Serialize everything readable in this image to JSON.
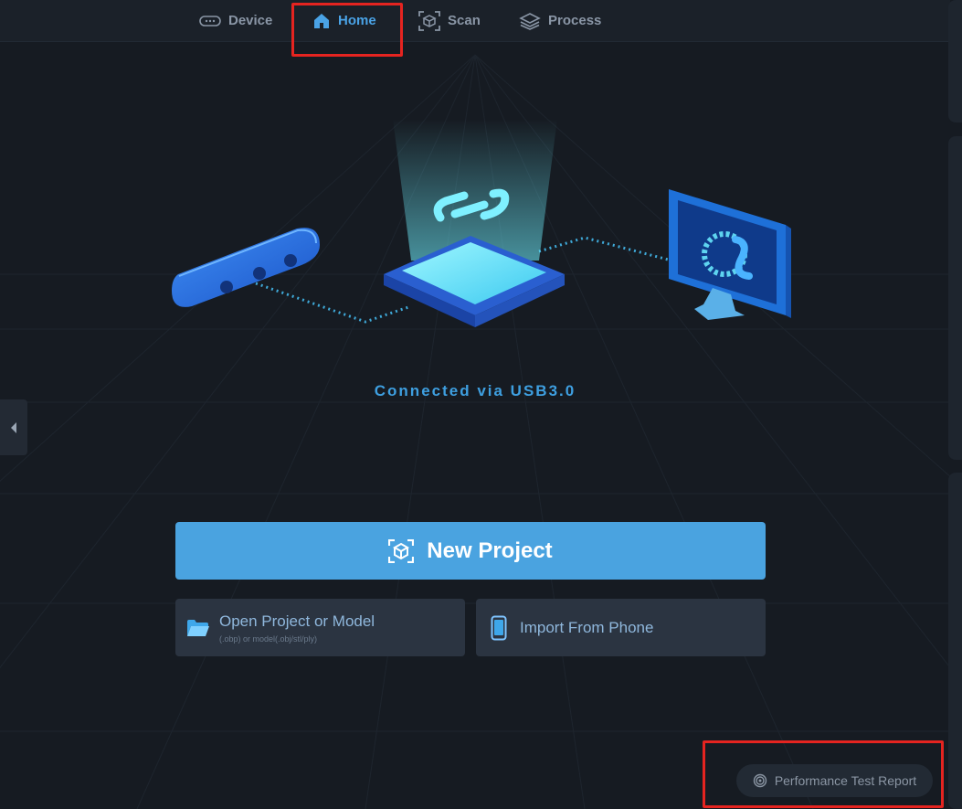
{
  "nav": {
    "tabs": [
      {
        "label": "Device",
        "icon": "device-icon"
      },
      {
        "label": "Home",
        "icon": "home-icon",
        "active": true
      },
      {
        "label": "Scan",
        "icon": "scan-icon"
      },
      {
        "label": "Process",
        "icon": "layers-icon"
      }
    ]
  },
  "status": {
    "text": "Connected via  USB3.0"
  },
  "actions": {
    "new_project": "New Project",
    "open_project": "Open Project or Model",
    "open_project_hint": "(.obp) or model(.obj/stl/ply)",
    "import_phone": "Import From Phone"
  },
  "footer": {
    "report": "Performance Test Report"
  },
  "colors": {
    "accent": "#4aa3e0",
    "background": "#161b22",
    "highlight": "#e52420"
  }
}
